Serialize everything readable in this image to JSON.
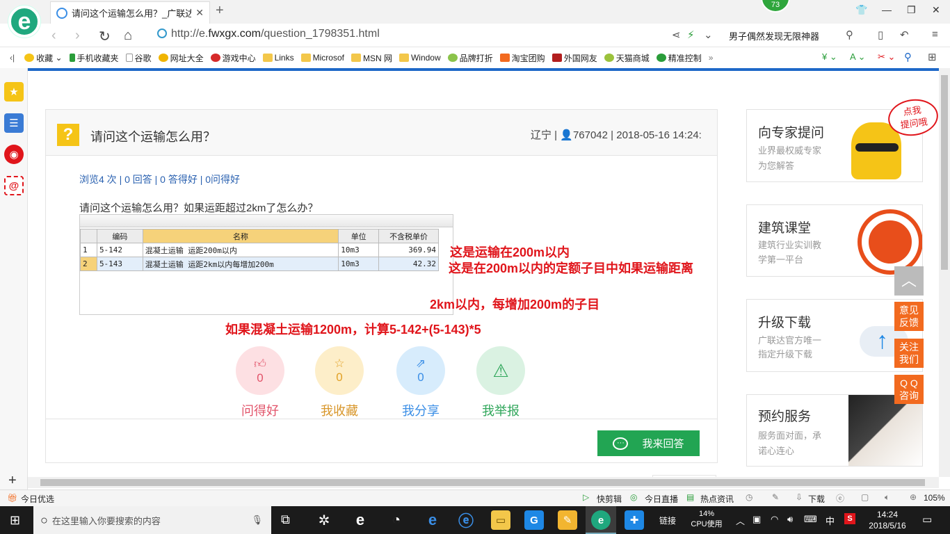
{
  "browser": {
    "tab_title": "请问这个运输怎么用？_广联达服",
    "badge": "73",
    "url_prefix": "http://e.",
    "url_host": "fwxgx.com",
    "url_path": "/question_1798351.html",
    "search_text": "男子偶然发现无限神器"
  },
  "bookmarks": [
    "收藏",
    "手机收藏夹",
    "谷歌",
    "网址大全",
    "游戏中心",
    "Links",
    "Microsof",
    "MSN 网",
    "Window",
    "品牌打折",
    "淘宝团购",
    "外国网友",
    "天猫商城",
    "精准控制"
  ],
  "question": {
    "title": "请问这个运输怎么用？",
    "meta_region": "辽宁 |",
    "meta_user": "767042 | 2018-05-16 14:24:",
    "stats": "浏览4 次 | 0 回答 | 0 答得好 | 0问得好",
    "body": "请问这个运输怎么用？如果运距超过2km了怎么办？"
  },
  "table": {
    "headers": [
      "",
      "编码",
      "名称",
      "单位",
      "不含税单价"
    ],
    "rows": [
      {
        "n": "1",
        "code": "5-142",
        "name": "混凝土运输 运距200m以内",
        "unit": "10m3",
        "price": "369.94"
      },
      {
        "n": "2",
        "code": "5-143",
        "name": "混凝土运输 运距2km以内每增加200m",
        "unit": "10m3",
        "price": "42.32"
      }
    ]
  },
  "annotations": {
    "a1": "这是运输在200m以内",
    "a2": "这是在200m以内的定额子目中如果运输距离",
    "a3": "2km以内，每增加200m的子目",
    "a4": "如果混凝土运输1200m，计算5-142+(5-143)*5"
  },
  "actions": [
    {
      "label": "问得好",
      "count": "0",
      "icon": "thumb-up-icon"
    },
    {
      "label": "我收藏",
      "count": "0",
      "icon": "star-icon"
    },
    {
      "label": "我分享",
      "count": "0",
      "icon": "share-icon"
    },
    {
      "label": "我举报",
      "count": "",
      "icon": "warning-icon"
    }
  ],
  "answer_button": "我来回答",
  "right_cards": [
    {
      "title": "向专家提问",
      "sub1": "业界最权威专家",
      "sub2": "为您解答",
      "bubble1": "点我",
      "bubble2": "提问哦"
    },
    {
      "title": "建筑课堂",
      "sub1": "建筑行业实训教",
      "sub2": "学第一平台"
    },
    {
      "title": "升级下载",
      "sub1": "广联达官方唯一",
      "sub2": "指定升级下载"
    },
    {
      "title": "预约服务",
      "sub1": "服务面对面，承",
      "sub2": "诺心连心"
    }
  ],
  "float_buttons": [
    "意见反馈",
    "关注我们",
    "QQ咨询"
  ],
  "float_lines": {
    "f1a": "意见",
    "f1b": "反馈",
    "f2a": "关注",
    "f2b": "我们",
    "f3a": "Q Q",
    "f3b": "咨询"
  },
  "statusbar": {
    "left": "今日优选",
    "items": [
      "快剪辑",
      "今日直播",
      "热点资讯",
      "下载"
    ],
    "zoom": "105%"
  },
  "taskbar": {
    "search_placeholder": "在这里输入你要搜索的内容",
    "links": "链接",
    "cpu_pct": "14%",
    "cpu_label": "CPU使用",
    "ime": "中",
    "time": "14:24",
    "date": "2018/5/16"
  },
  "colors": {
    "accent_blue": "#1e68c8",
    "annotation_red": "#e0151b",
    "answer_green": "#22a553",
    "float_orange": "#f26a1f"
  }
}
